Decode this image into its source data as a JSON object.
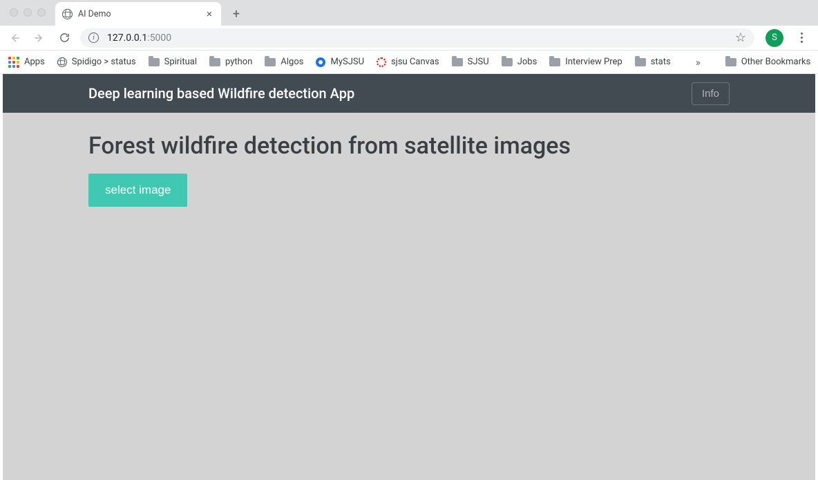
{
  "browser": {
    "tab_title": "AI Demo",
    "url_host": "127.0.0.1",
    "url_port": ":5000",
    "avatar_initial": "S",
    "bookmarks": {
      "apps": "Apps",
      "items": [
        {
          "label": "Spidigo > status",
          "icon": "globe"
        },
        {
          "label": "Spiritual",
          "icon": "folder"
        },
        {
          "label": "python",
          "icon": "folder"
        },
        {
          "label": "Algos",
          "icon": "folder"
        },
        {
          "label": "MySJSU",
          "icon": "circle"
        },
        {
          "label": "sjsu Canvas",
          "icon": "canvas"
        },
        {
          "label": "SJSU",
          "icon": "folder"
        },
        {
          "label": "Jobs",
          "icon": "folder"
        },
        {
          "label": "Interview Prep",
          "icon": "folder"
        },
        {
          "label": "stats",
          "icon": "folder"
        }
      ],
      "overflow": "»",
      "other": "Other Bookmarks"
    }
  },
  "app": {
    "header_title": "Deep learning based Wildfire detection App",
    "info_label": "Info",
    "page_heading": "Forest wildfire detection from satellite images",
    "select_image_label": "select image"
  }
}
